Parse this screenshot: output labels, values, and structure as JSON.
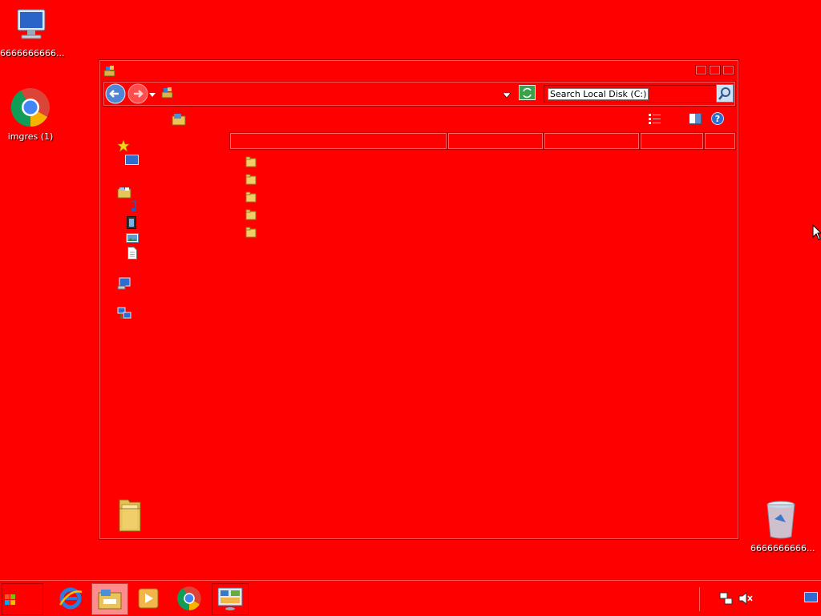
{
  "desktop": {
    "icons": [
      {
        "label": "6666666666...",
        "icon": "computer-icon"
      },
      {
        "label": "imgres (1)",
        "icon": "chrome-icon"
      },
      {
        "label": "6666666666...",
        "icon": "recycle-bin-icon"
      }
    ]
  },
  "window": {
    "search": {
      "placeholder": "Search Local Disk (C:)"
    },
    "nav_pane": [
      "favorites-icon",
      "desktop-icon",
      "libraries-icon",
      "music-icon",
      "videos-icon",
      "pictures-icon",
      "documents-icon",
      "computer-icon",
      "network-icon"
    ],
    "file_rows": 5,
    "colors": {
      "background": "#fe0000",
      "border": "#9a0000"
    }
  },
  "taskbar": {
    "items": [
      "start-button",
      "internet-explorer-icon",
      "file-explorer-icon",
      "media-player-icon",
      "chrome-icon",
      "control-panel-icon"
    ],
    "tray": [
      "network-icon",
      "volume-muted-icon",
      "show-desktop-icon"
    ]
  }
}
